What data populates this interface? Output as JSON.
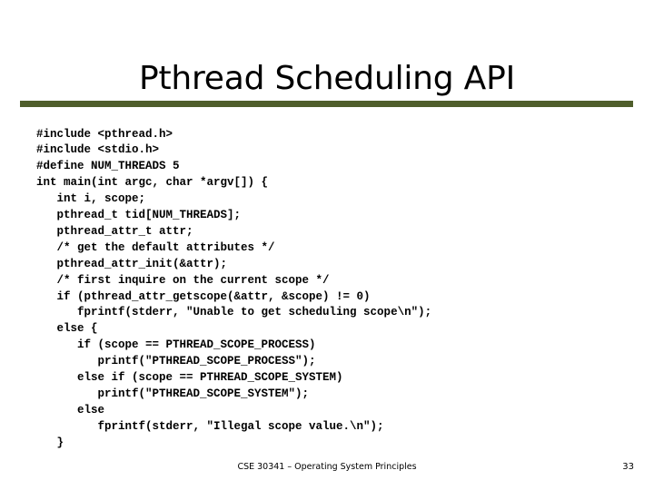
{
  "slide": {
    "title": "Pthread Scheduling API",
    "accent_color": "#4F5E2B",
    "background_color": "#FFFFFF",
    "text_color": "#000000"
  },
  "code": {
    "language": "c",
    "lines": [
      "#include <pthread.h>",
      "#include <stdio.h>",
      "#define NUM_THREADS 5",
      "int main(int argc, char *argv[]) {",
      "   int i, scope;",
      "   pthread_t tid[NUM_THREADS];",
      "   pthread_attr_t attr;",
      "   /* get the default attributes */",
      "   pthread_attr_init(&attr);",
      "   /* first inquire on the current scope */",
      "   if (pthread_attr_getscope(&attr, &scope) != 0)",
      "      fprintf(stderr, \"Unable to get scheduling scope\\n\");",
      "   else {",
      "      if (scope == PTHREAD_SCOPE_PROCESS)",
      "         printf(\"PTHREAD_SCOPE_PROCESS\");",
      "      else if (scope == PTHREAD_SCOPE_SYSTEM)",
      "         printf(\"PTHREAD_SCOPE_SYSTEM\");",
      "      else",
      "         fprintf(stderr, \"Illegal scope value.\\n\");",
      "   }"
    ]
  },
  "footer": {
    "course_text": "CSE 30341 – Operating System Principles",
    "page_number": "33"
  }
}
